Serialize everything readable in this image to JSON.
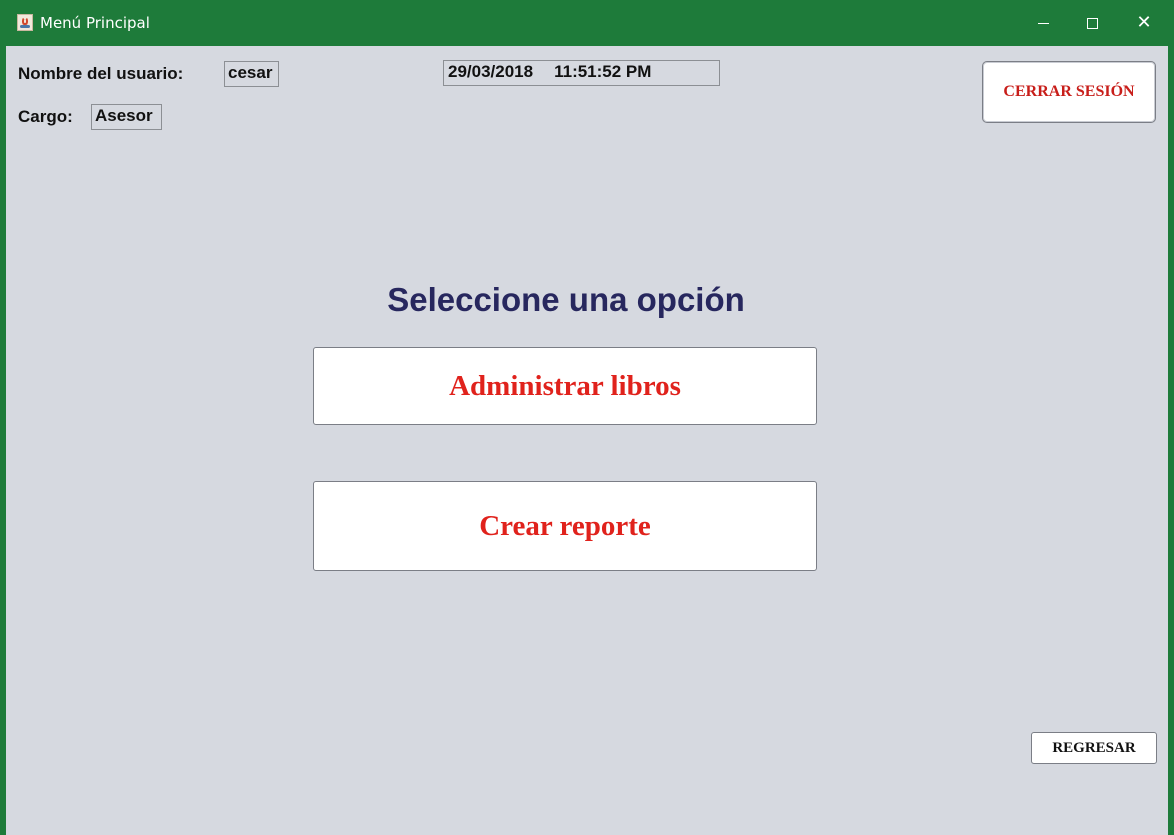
{
  "window": {
    "title": "Menú Principal",
    "close_glyph": "✕"
  },
  "user": {
    "name_label": "Nombre del usuario:",
    "name_value": "cesar",
    "role_label": "Cargo:",
    "role_value": "Asesor"
  },
  "datetime": {
    "date": "29/03/2018",
    "time": "11:51:52 PM"
  },
  "main": {
    "heading": "Seleccione una opción",
    "admin_books_label": "Administrar libros",
    "create_report_label": "Crear reporte"
  },
  "actions": {
    "logout_label": "CERRAR SESIÓN",
    "back_label": "REGRESAR"
  },
  "colors": {
    "titlebar": "#1e7b3a",
    "background": "#d6d9e0",
    "heading": "#27275e",
    "button_text_red": "#e0221c"
  },
  "icons": {
    "app": "java-app-icon",
    "minimize": "minimize-icon",
    "maximize": "maximize-icon",
    "close": "close-icon"
  }
}
